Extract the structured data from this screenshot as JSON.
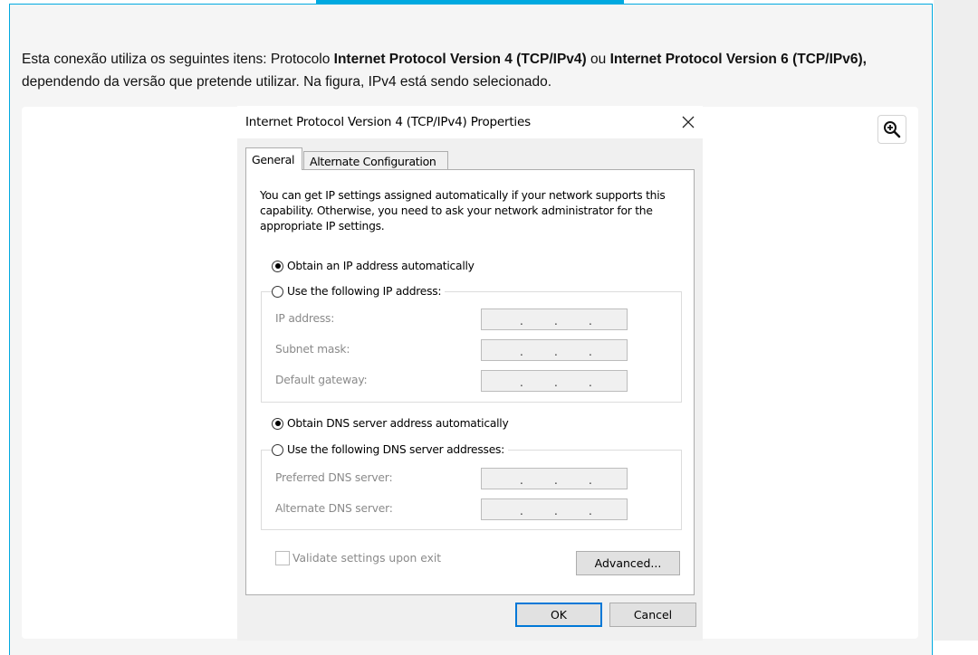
{
  "intro": {
    "p1": "Esta conexão utiliza os seguintes itens: Protocolo ",
    "b1": "Internet Protocol Version 4 (TCP/IPv4)",
    "p2": " ou ",
    "b2": "Internet Protocol Version 6 (TCP/IPv6),",
    "p3": " dependendo da versão que pretende utilizar. Na figura, IPv4 está sendo selecionado."
  },
  "zoom": {
    "icon": "zoom-in-icon"
  },
  "dialog": {
    "title": "Internet Protocol Version 4 (TCP/IPv4) Properties",
    "close_icon": "close-icon",
    "tabs": [
      "General",
      "Alternate Configuration"
    ],
    "active_tab": "General",
    "description": "You can get IP settings assigned automatically if your network supports this capability. Otherwise, you need to ask your network administrator for the appropriate IP settings.",
    "ip_auto": {
      "label": "Obtain an IP address automatically",
      "checked": true
    },
    "ip_manual": {
      "label": "Use the following IP address:",
      "checked": false
    },
    "ip_fields": [
      {
        "label": "IP address:"
      },
      {
        "label": "Subnet mask:"
      },
      {
        "label": "Default gateway:"
      }
    ],
    "dns_auto": {
      "label": "Obtain DNS server address automatically",
      "checked": true
    },
    "dns_manual": {
      "label": "Use the following DNS server addresses:",
      "checked": false
    },
    "dns_fields": [
      {
        "label": "Preferred DNS server:"
      },
      {
        "label": "Alternate DNS server:"
      }
    ],
    "validate": {
      "label": "Validate settings upon exit",
      "checked": false
    },
    "advanced_label": "Advanced...",
    "ok_label": "OK",
    "cancel_label": "Cancel"
  },
  "colors": {
    "accent": "#00a9e0",
    "focus": "#0078d7"
  }
}
